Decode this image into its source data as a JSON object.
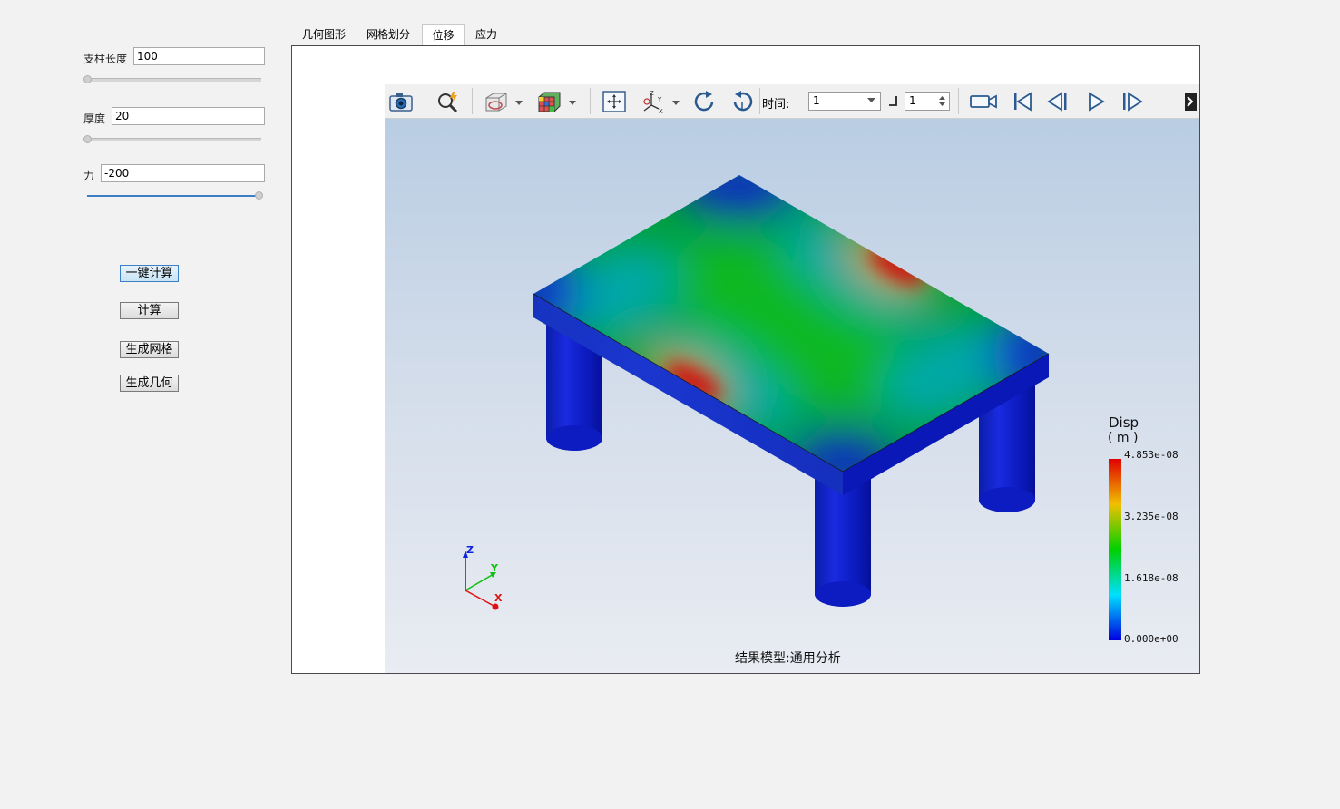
{
  "controls": {
    "pillar_length": {
      "label": "支柱长度",
      "value": "100"
    },
    "thickness": {
      "label": "厚度",
      "value": "20"
    },
    "force": {
      "label": "力",
      "value": "-200"
    }
  },
  "buttons": {
    "one_click_compute": "一键计算",
    "compute": "计算",
    "generate_mesh": "生成网格",
    "generate_geometry": "生成几何"
  },
  "tabs": [
    "几何图形",
    "网格划分",
    "位移",
    "应力"
  ],
  "active_tab": "位移",
  "toolbar": {
    "time_label": "时间:",
    "time_value": "1",
    "step_value": "1",
    "icons": [
      "camera-icon",
      "zoom-icon",
      "view-mode-icon",
      "color-cube-icon",
      "fit-view-icon",
      "axes-icon",
      "rotate-cw-icon",
      "rotate-ccw-icon",
      "record-icon",
      "first-frame-icon",
      "prev-frame-icon",
      "play-icon",
      "next-frame-icon",
      "more-icon"
    ]
  },
  "legend": {
    "title": "Disp",
    "unit": "( m )",
    "labels": [
      "4.853e-08",
      "3.235e-08",
      "1.618e-08",
      "0.000e+00"
    ],
    "colors": [
      "#e00000",
      "#f0c000",
      "#00d000",
      "#00e0ff",
      "#0000e0"
    ]
  },
  "axes": {
    "x": "X",
    "y": "Y",
    "z": "Z"
  },
  "result_caption": "结果模型:通用分析"
}
